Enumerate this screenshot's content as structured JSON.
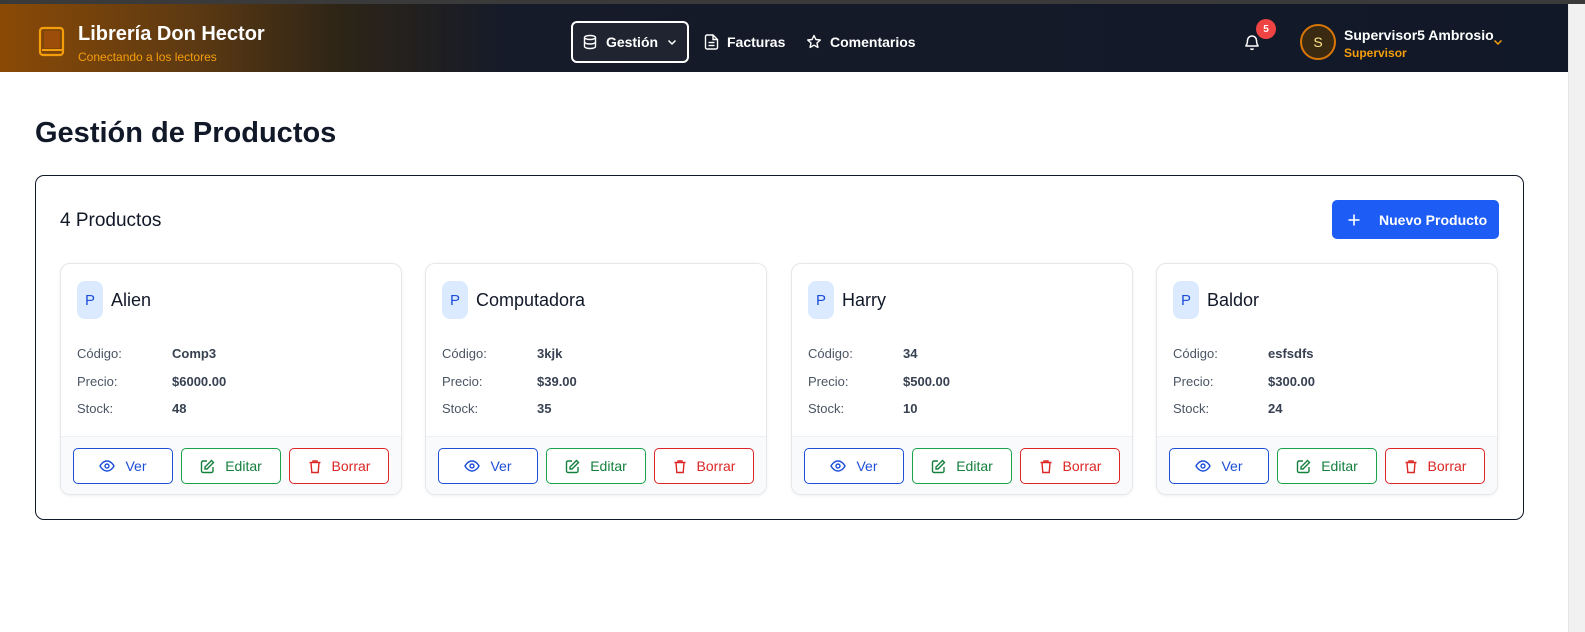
{
  "brand": {
    "title": "Librería Don Hector",
    "subtitle": "Conectando a los lectores"
  },
  "nav": {
    "gestion_label": "Gestión",
    "facturas_label": "Facturas",
    "comentarios_label": "Comentarios"
  },
  "notifications": {
    "count": "5"
  },
  "user": {
    "initial": "S",
    "name": "Supervisor5 Ambrosio",
    "role": "Supervisor"
  },
  "page": {
    "title": "Gestión de Productos"
  },
  "panel": {
    "count_label": "4 Productos",
    "new_button": "Nuevo Producto"
  },
  "labels": {
    "codigo": "Código:",
    "precio": "Precio:",
    "stock": "Stock:",
    "ver": "Ver",
    "editar": "Editar",
    "borrar": "Borrar"
  },
  "products": [
    {
      "initial": "P",
      "name": "Alien",
      "codigo": "Comp3",
      "precio": "$6000.00",
      "stock": "48"
    },
    {
      "initial": "P",
      "name": "Computadora",
      "codigo": "3kjk",
      "precio": "$39.00",
      "stock": "35"
    },
    {
      "initial": "P",
      "name": "Harry",
      "codigo": "34",
      "precio": "$500.00",
      "stock": "10"
    },
    {
      "initial": "P",
      "name": "Baldor",
      "codigo": "esfsdfs",
      "precio": "$300.00",
      "stock": "24"
    }
  ],
  "colors": {
    "accent": "#1d5cf5",
    "brand_orange": "#f59e0b",
    "navbar": "#111827",
    "success": "#16a34a",
    "danger": "#dc2626"
  }
}
